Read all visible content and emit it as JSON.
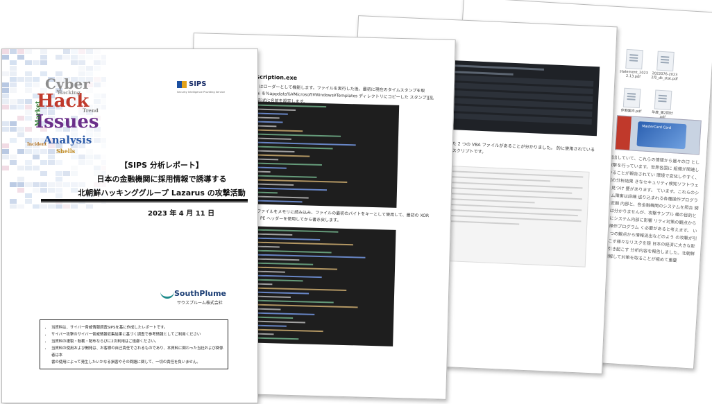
{
  "cover": {
    "label": "【SIPS 分析レポート】",
    "title_line1": "日本の金融機関に採用情報で誘導する",
    "title_line2": "北朝鮮ハッキンググループ Lazarus の攻撃活動",
    "date": "2023 年 4 月 11 日",
    "sips_logo": "SIPS",
    "sips_tagline": "Security Intelligence Providing Service",
    "company_logo": "SouthPlume",
    "company_name": "サウスプルーム株式会社",
    "notices": [
      "当資料は、サイバー脅威情報調査SIPSを基に作成したレポートです。",
      "サイバー攻撃のサイバー脅威情報収集結果に基づく調査で参考情報としてご利用ください",
      "当資料の複製・転載・配布ならびに2次利用はご遠慮ください。",
      "当資料の使用および開発は、お客様の自己責任でされるものであり、本資料に関わった当社および関係者は本",
      "書の使用によって発生したいかなる損害やその問題に関して、一切の責任を負いません。"
    ],
    "wordcloud": [
      "Cyber",
      "Hack",
      "Issues",
      "Analysis",
      "Hacking",
      "Market",
      "Incident",
      "Shells",
      "Trend"
    ]
  },
  "page2": {
    "section_heading": "description.exe",
    "para1": "ion.exe はローダーとして機能します。ファイルを実行した後、最初に現在のタイムスタンプを取 Dump.bi を%appdata%¥Microsoft¥Windows¥Templates ディレクトリにコピーした スタンプ][乱数].bin\"形式に名前を設定します。",
    "para2": "れた.bin ファイルをメモリに読み込み、ファイルの最初のバイトをキーとして使用して、最初の XOR 復号化し、PE ヘッダーを使用してから書き戻します。"
  },
  "page3": {
    "para": "られた 2 つの VBA ファイルがあることが分かりました。 的に使用されている vbs スクリプトです。"
  },
  "page4": {
    "files": [
      "statement_2023 2.13.pdf",
      "2022076-2023 2月_dk_stat.pdf",
      "休暇案内.pdf",
      "年度_第2回分 .pdf"
    ],
    "card_caption": "MasterCard Card",
    "para": "%流出していて、これらの情報から最々の口 とした攻撃を行っています。世界各国に 組織が関連していることが報告されてい 環境で変化しやすく、今回の分析結果 きなセキュリティ検知ソフトウェアを見つけ 要があります。 ています。これらのシステム障害は詳細 送り込まれる各種操作プログラムは近期 内部と、各金融機関のシステムを照合 関しては分かりませんが、攻撃サンプル 織の目的とは別にシステム内部に影響 リティ対策の観点からは、操作プログラム く必要があると考えます。 いう 3 つの観点から情報流出などのよう の攻撃が引き起こす様々なリスクを隠 日本の経済に大きな影響を引き起こす 分析内容を報告しました。北朝鮮か 理解して対策を取ることが極めて重要"
  },
  "colors": {
    "code_bg": "#1e1e1e",
    "sips_blue": "#1b4fa0",
    "sips_gold": "#e3a21a",
    "southplume_teal": "#1e8b8b"
  }
}
